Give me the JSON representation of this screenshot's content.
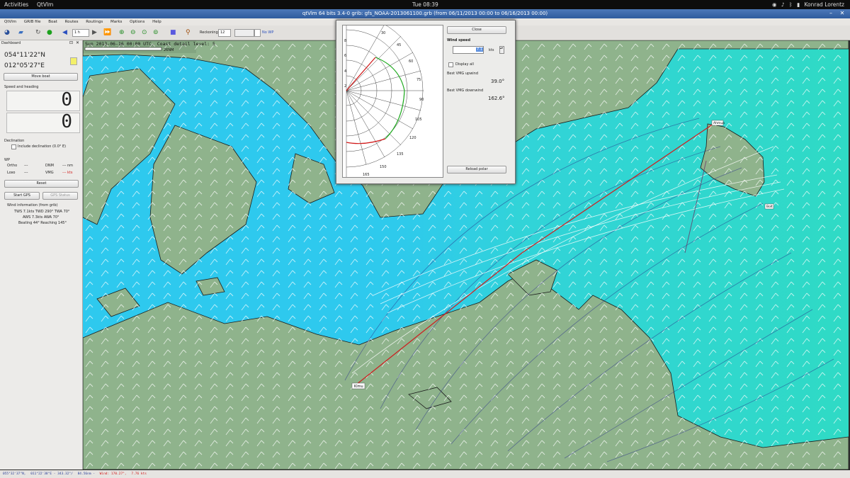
{
  "topbar": {
    "activities": "Activities",
    "app_name": "QtVlm",
    "clock": "Tue 08:39",
    "user": "Konrad Lorentz"
  },
  "window": {
    "title": "qtVlm 64 bits 3.4-0 grib: gfs_NOAA-2013061100.grb (from 06/11/2013 00:00 to 06/16/2013 00:00)"
  },
  "menu": [
    "QtVlm",
    "GRIB file",
    "Boat",
    "Routes",
    "Routings",
    "Marks",
    "Options",
    "Help"
  ],
  "toolbar": {
    "step_value": "1 h",
    "reckoning_label": "Reckoning",
    "reckoning_value": "12",
    "no_wp_label": "No WP"
  },
  "map": {
    "header": "Sun 2013-06-16 00:00 UTC. Coast detail level: 5",
    "scale_label": "26NM",
    "labels": {
      "start": "Klmu",
      "end_top": "Ahmua",
      "end_bottom": "Bolt"
    }
  },
  "dashboard": {
    "title": "Dashboard",
    "latitude": "054°11'22\"N",
    "longitude": "012°05'27\"E",
    "move_boat": "Move boat",
    "speed_heading_label": "Speed and heading",
    "speed_value": "0",
    "heading_value": "0",
    "declination_label": "Declination",
    "declination_checkbox": "Include declination (0.0° E)",
    "wp_label": "WP",
    "ortho_label": "Ortho",
    "ortho_value": "---",
    "dnm_label": "DNM",
    "dnm_value": "--- nm",
    "loxo_label": "Loxo",
    "loxo_value": "---",
    "vmg_label": "VMG",
    "vmg_value": "--- kts",
    "reset": "Reset",
    "start_gps": "Start GPS",
    "gps_status": "GPS Status",
    "wind_info_title": "Wind information (from grib)",
    "wind_line1": "TWS 7.1kts TWD 290° TWA 70°",
    "wind_line2": "AWS 7.3kts AWA 70°",
    "wind_line3": "Beating 44° Reaching 145°"
  },
  "polar_dialog": {
    "close": "Close",
    "wind_speed_label": "Wind speed",
    "wind_speed_value": "7.1",
    "wind_speed_unit": "kts",
    "display_all": "Display all",
    "best_upwind_label": "Best VMG upwind",
    "best_upwind_value": "39.0°",
    "best_downwind_label": "Best VMG downwind",
    "best_downwind_value": "162.6°",
    "reload": "Reload polar",
    "radial_labels": [
      "8",
      "6",
      "4",
      "2"
    ],
    "angle_labels": [
      "30",
      "45",
      "60",
      "75",
      "90",
      "105",
      "120",
      "135",
      "150",
      "165"
    ]
  },
  "statusbar": {
    "lat": "055°32'37\"N,",
    "lon": "011°22'38\"E - 343.32°/",
    "dist": "84.56nm -",
    "wind": "Wind: 170.27°,",
    "speed": "7.76 kts"
  },
  "colors": {
    "sea": "#2ec9ee",
    "land": "#8fb38c",
    "route": "#cc2222",
    "polar_green": "#1faa1f",
    "polar_red": "#d01818"
  }
}
